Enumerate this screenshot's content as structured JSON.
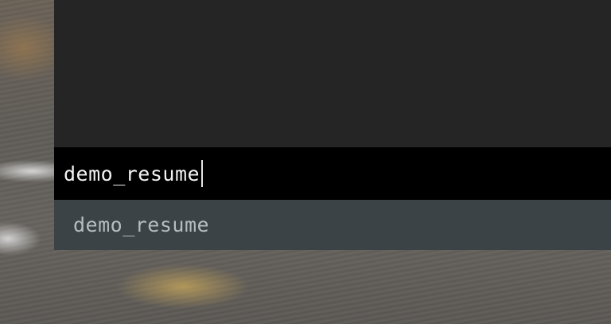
{
  "console": {
    "input_value": "demo_resume",
    "suggestions": [
      {
        "label": "demo_resume"
      }
    ]
  },
  "colors": {
    "output_background": "#252525",
    "input_background": "#000000",
    "suggestion_background": "#3b4347",
    "input_text": "#f2f2f2",
    "suggestion_text": "#b7bcbf"
  }
}
